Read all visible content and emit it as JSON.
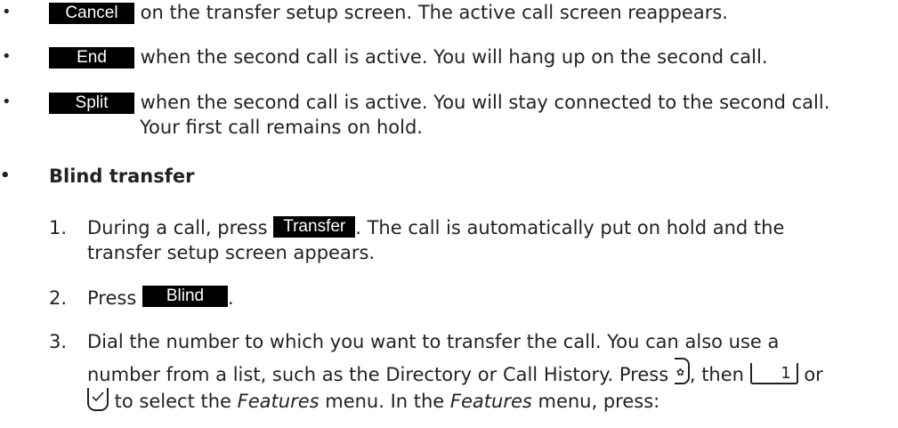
{
  "bullets": [
    {
      "softkey": "Cancel",
      "text": " on the transfer setup screen. The active call screen reappears."
    },
    {
      "softkey": "End",
      "text": " when the second call is active. You will hang up on the second call."
    },
    {
      "softkey": "Split",
      "text": " when the second call is active. You will stay connected to the second call.",
      "text2": "Your first call remains on hold."
    }
  ],
  "section": {
    "heading": "Blind transfer",
    "steps": [
      {
        "num": "1.",
        "pre": "During a call, press ",
        "softkey": "Transfer",
        "post": ". The call is automatically put on hold and the",
        "line2": "transfer setup screen appears."
      },
      {
        "num": "2.",
        "pre": "Press ",
        "softkey": "Blind",
        "post": "."
      },
      {
        "num": "3.",
        "line1": "Dial the number to which you want to transfer the call.  You can also use a",
        "line2_pre": "number from a list, such as the Directory or Call History.  Press ",
        "line2_mid": ", then ",
        "line2_post": " or",
        "key1_label": "1",
        "line3_post": " to select the ",
        "features_word": "Features",
        "line3_mid": " menu.  In the ",
        "line3_end": " menu, press:"
      }
    ]
  },
  "icons": {
    "menu_key": "menu-key-icon",
    "key_1": "key-1-icon",
    "ok_key": "ok-key-icon"
  }
}
